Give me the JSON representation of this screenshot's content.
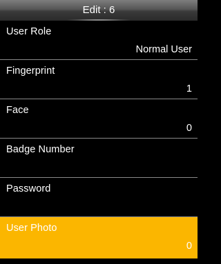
{
  "window": {
    "title": "Edit : 6"
  },
  "colors": {
    "selected": "#fbb600",
    "background": "#000000"
  },
  "menu": {
    "items": [
      {
        "label": "User Role",
        "value": "Normal User"
      },
      {
        "label": "Fingerprint",
        "value": "1"
      },
      {
        "label": "Face",
        "value": "0"
      },
      {
        "label": "Badge Number",
        "value": ""
      },
      {
        "label": "Password",
        "value": ""
      },
      {
        "label": "User Photo",
        "value": "0",
        "selected": true
      }
    ]
  }
}
